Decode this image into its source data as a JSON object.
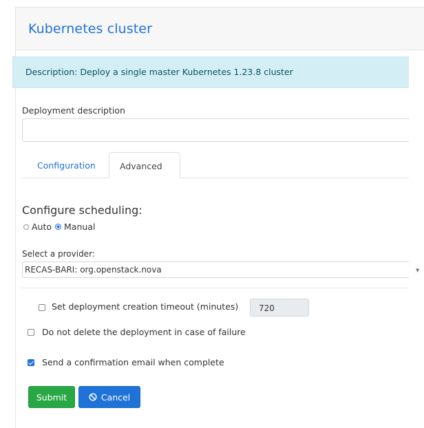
{
  "header": {
    "title": "Kubernetes cluster"
  },
  "alert": {
    "text": "Description: Deploy a single master Kubernetes 1.23.8 cluster"
  },
  "deployment_description": {
    "label": "Deployment description",
    "value": "",
    "placeholder": ""
  },
  "tabs": [
    {
      "label": "Configuration",
      "active": false
    },
    {
      "label": "Advanced",
      "active": true
    }
  ],
  "scheduling": {
    "title": "Configure scheduling:",
    "options": [
      {
        "label": "Auto",
        "checked": false
      },
      {
        "label": "Manual",
        "checked": true
      }
    ]
  },
  "provider": {
    "label": "Select a provider:",
    "selected": "RECAS-BARI: org.openstack.nova"
  },
  "timeout": {
    "label": "Set deployment creation timeout (minutes)",
    "checked": false,
    "value": "720"
  },
  "keep_on_failure": {
    "label": "Do not delete the deployment in case of failure",
    "checked": false
  },
  "confirmation_email": {
    "label": "Send a confirmation email when complete",
    "checked": true
  },
  "actions": {
    "submit_label": "Submit",
    "cancel_label": "Cancel"
  },
  "colors": {
    "primary": "#1f72d8",
    "success": "#28a745",
    "alert_bg": "#d3eef5"
  }
}
